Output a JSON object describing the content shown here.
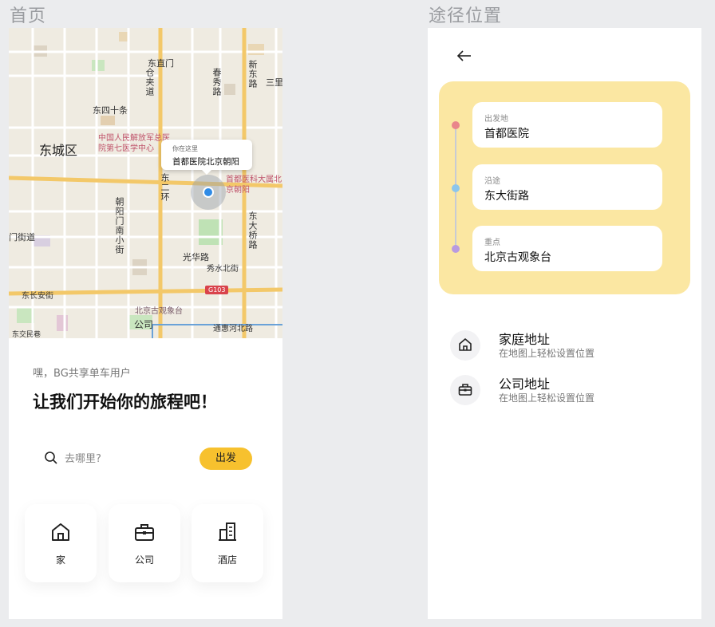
{
  "screens": {
    "home_title": "首页",
    "route_title": "途径位置"
  },
  "map": {
    "district": "东城区",
    "streets": [
      "东直门",
      "仓夹道",
      "春秀路",
      "新东路",
      "三里",
      "东四十条",
      "东二环",
      "朝阳门南小街",
      "门街道",
      "光华路",
      "秀水北街",
      "东大桥路",
      "东长安街",
      "北京古观象台",
      "公司",
      "通惠河北路",
      "东交民巷",
      "G103"
    ],
    "hospital_left": "中国人民解放军总医院第七医学中心",
    "hospital_right": "首都医科大属北京朝阳",
    "callout_caption": "你在这里",
    "callout_location": "首都医院北京朝阳",
    "road_badge": "G103"
  },
  "home": {
    "greeting": "嘿，BG共享单车用户",
    "headline": "让我们开始你的旅程吧！",
    "search_placeholder": "去哪里?",
    "go_label": "出发",
    "quick": [
      {
        "label": "家",
        "icon": "home-icon"
      },
      {
        "label": "公司",
        "icon": "briefcase-icon"
      },
      {
        "label": "酒店",
        "icon": "hotel-icon"
      }
    ]
  },
  "route": {
    "stops": [
      {
        "key": "出发地",
        "value": "首都医院",
        "color": "#e9868b"
      },
      {
        "key": "沿途",
        "value": "东大街路",
        "color": "#8cc6ec"
      },
      {
        "key": "重点",
        "value": "北京古观象台",
        "color": "#b99be0"
      }
    ],
    "addresses": [
      {
        "title": "家庭地址",
        "sub": "在地图上轻松设置位置",
        "icon": "home-icon"
      },
      {
        "title": "公司地址",
        "sub": "在地图上轻松设置位置",
        "icon": "briefcase-icon"
      }
    ]
  },
  "colors": {
    "accent": "#f7c12e",
    "route_card": "#fbe7a2",
    "pin": "#2f8be6"
  }
}
